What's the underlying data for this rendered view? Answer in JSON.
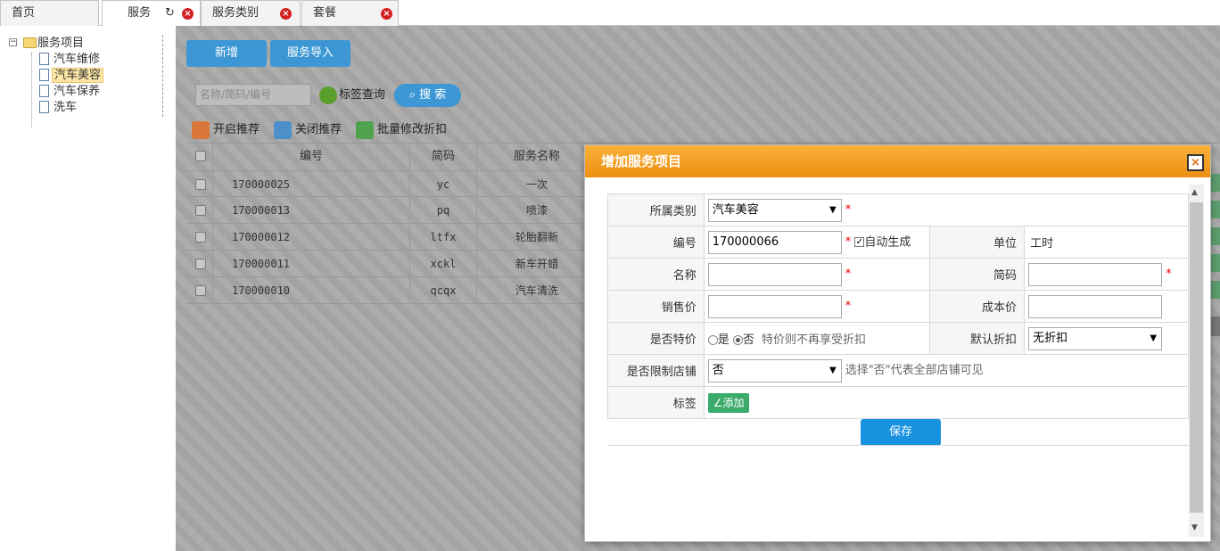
{
  "tabs": [
    {
      "label": "首页"
    },
    {
      "label": "服务"
    },
    {
      "label": "服务类别"
    },
    {
      "label": "套餐"
    }
  ],
  "tree": {
    "root": "服务项目",
    "items": [
      "汽车维修",
      "汽车美容",
      "汽车保养",
      "洗车"
    ],
    "selected": "汽车美容"
  },
  "toolbar": {
    "add": "新增",
    "import": "服务导入",
    "search_placeholder": "名称/简码/编号",
    "tag_query": "标签查询",
    "search": "搜 索",
    "open_recommend": "开启推荐",
    "close_recommend": "关闭推荐",
    "batch_discount": "批量修改折扣"
  },
  "grid": {
    "headers": [
      "编号",
      "简码",
      "服务名称"
    ],
    "rows": [
      {
        "code": "170000025",
        "short": "yc",
        "name": "一次"
      },
      {
        "code": "170000013",
        "short": "pq",
        "name": "喷漆"
      },
      {
        "code": "170000012",
        "short": "ltfx",
        "name": "轮胎翻新"
      },
      {
        "code": "170000011",
        "short": "xckl",
        "name": "新车开蜡"
      },
      {
        "code": "170000010",
        "short": "qcqx",
        "name": "汽车清洗"
      }
    ]
  },
  "dialog": {
    "title": "增加服务项目",
    "close": "×",
    "category_label": "所属类别",
    "category_value": "汽车美容",
    "code_label": "编号",
    "code_value": "170000066",
    "auto_gen": "自动生成",
    "unit_label": "单位",
    "unit_value": "工时",
    "name_label": "名称",
    "short_label": "简码",
    "price_label": "销售价",
    "cost_label": "成本价",
    "special_label": "是否特价",
    "special_yes": "是",
    "special_no": "否",
    "special_hint": "特价则不再享受折扣",
    "discount_label": "默认折扣",
    "discount_value": "无折扣",
    "limit_label": "是否限制店铺",
    "limit_value": "否",
    "limit_hint": "选择\"否\"代表全部店铺可见",
    "tag_label": "标签",
    "tag_add": "∠添加",
    "required": "*",
    "save": "保存"
  }
}
